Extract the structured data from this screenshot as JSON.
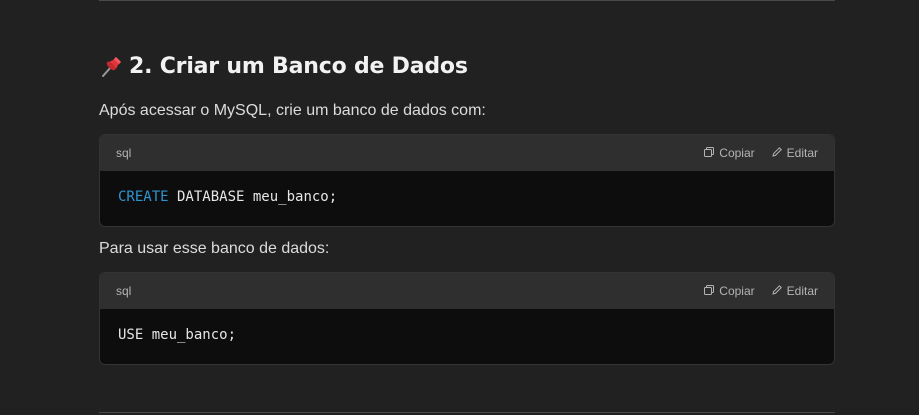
{
  "section": {
    "heading": "2. Criar um Banco de Dados",
    "heading_icon": "pushpin-icon",
    "intro": "Após acessar o MySQL, crie um banco de dados com:",
    "between": "Para usar esse banco de dados:"
  },
  "code_blocks": [
    {
      "language": "sql",
      "copy_label": "Copiar",
      "edit_label": "Editar",
      "keyword": "CREATE",
      "rest": " DATABASE meu_banco;"
    },
    {
      "language": "sql",
      "copy_label": "Copiar",
      "edit_label": "Editar",
      "keyword": "",
      "rest": "USE meu_banco;"
    }
  ],
  "colors": {
    "background": "#212121",
    "code_header": "#2f2f2f",
    "code_body": "#0d0d0d",
    "keyword": "#2e95d3"
  }
}
